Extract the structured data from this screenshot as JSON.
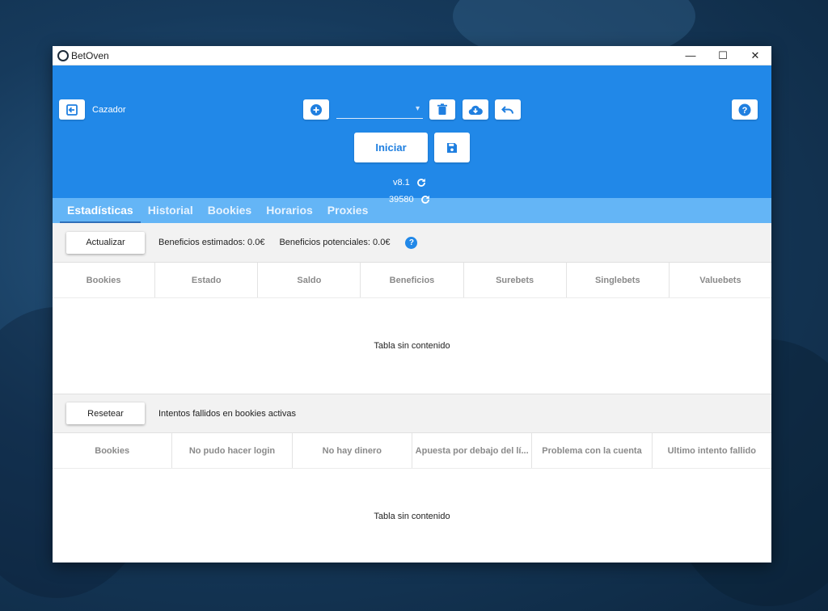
{
  "window": {
    "title": "BetOven",
    "controls": {
      "minimize": "—",
      "maximize": "☐",
      "close": "✕"
    }
  },
  "header": {
    "mode_label": "Cazador",
    "select_value": "",
    "start_label": "Iniciar",
    "version": "v8.1",
    "build": "39580",
    "icons": {
      "exit": "exit-icon",
      "add": "plus-circle-icon",
      "delete": "trash-icon",
      "cloud": "cloud-download-icon",
      "undo": "undo-icon",
      "help": "help-icon",
      "save": "save-icon",
      "refresh": "refresh-icon"
    },
    "colors": {
      "primary": "#2188e8",
      "tabs": "#64b5f6"
    }
  },
  "tabs": [
    {
      "label": "Estadísticas",
      "active": true
    },
    {
      "label": "Historial",
      "active": false
    },
    {
      "label": "Bookies",
      "active": false
    },
    {
      "label": "Horarios",
      "active": false
    },
    {
      "label": "Proxies",
      "active": false
    }
  ],
  "stats": {
    "button_label": "Actualizar",
    "estimated": "Beneficios estimados: 0.0€",
    "potential": "Beneficios potenciales: 0.0€",
    "columns": [
      "Bookies",
      "Estado",
      "Saldo",
      "Beneficios",
      "Surebets",
      "Singlebets",
      "Valuebets"
    ],
    "empty_text": "Tabla sin contenido"
  },
  "failures": {
    "button_label": "Resetear",
    "caption": "Intentos fallidos en bookies activas",
    "columns": [
      "Bookies",
      "No pudo hacer login",
      "No hay dinero",
      "Apuesta por debajo del lí...",
      "Problema con la cuenta",
      "Ultimo intento fallido"
    ],
    "empty_text": "Tabla sin contenido"
  }
}
